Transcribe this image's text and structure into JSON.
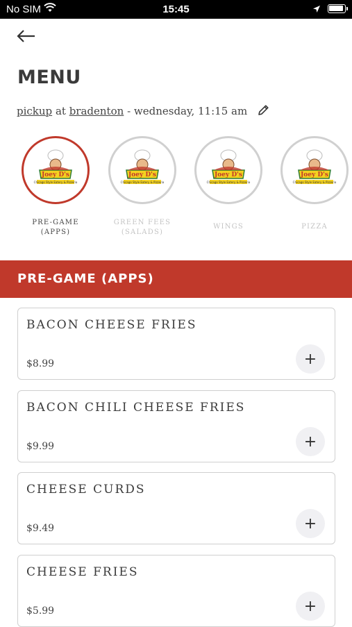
{
  "status_bar": {
    "carrier": "No SIM",
    "time": "15:45"
  },
  "header": {
    "title": "MENU"
  },
  "order_info": {
    "mode": "pickup",
    "connector": "at",
    "location": "bradenton",
    "schedule": "- wednesday, 11:15 am"
  },
  "categories": [
    {
      "label": "PRE-GAME (APPS)",
      "active": true
    },
    {
      "label": "GREEN FEES (SALADS)",
      "active": false
    },
    {
      "label": "WINGS",
      "active": false
    },
    {
      "label": "PIZZA",
      "active": false
    }
  ],
  "logo": {
    "brand_text": "Joey D's",
    "tagline": "Chicago Style Eatery & Pizzeria"
  },
  "section": {
    "title": "PRE-GAME (APPS)"
  },
  "items": [
    {
      "name": "BACON CHEESE FRIES",
      "price": "$8.99",
      "add_label": "+"
    },
    {
      "name": "BACON CHILI CHEESE FRIES",
      "price": "$9.99",
      "add_label": "+"
    },
    {
      "name": "CHEESE CURDS",
      "price": "$9.49",
      "add_label": "+"
    },
    {
      "name": "CHEESE FRIES",
      "price": "$5.99",
      "add_label": "+"
    }
  ],
  "colors": {
    "accent": "#c0392b",
    "inactive_border": "#d0d0d0"
  }
}
